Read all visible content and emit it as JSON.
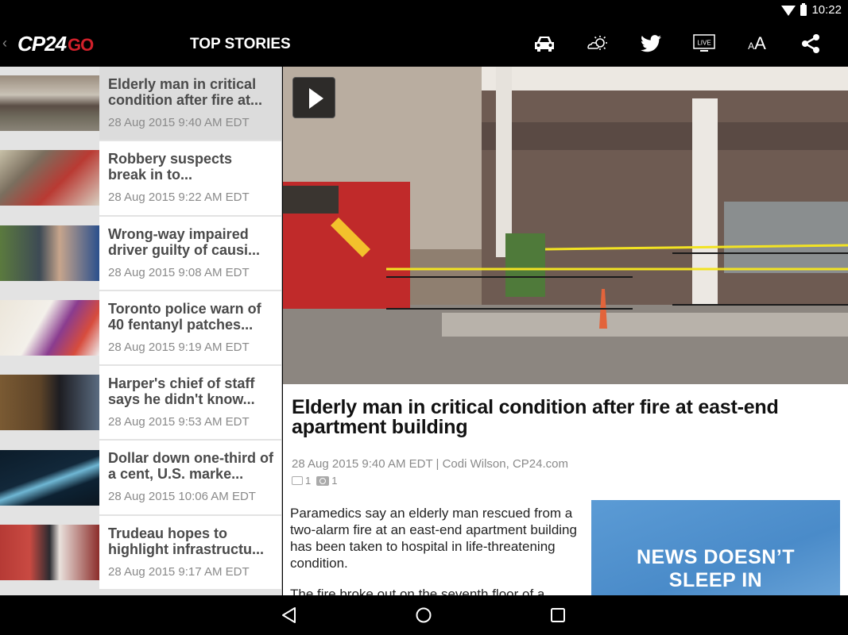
{
  "status_bar": {
    "time": "10:22",
    "icons": [
      "wifi-icon",
      "battery-icon"
    ]
  },
  "app_bar": {
    "logo_main": "CP24",
    "logo_suffix": "GO",
    "section_title": "TOP STORIES",
    "actions": [
      {
        "name": "traffic",
        "icon": "car-icon"
      },
      {
        "name": "weather",
        "icon": "weather-icon"
      },
      {
        "name": "twitter",
        "icon": "twitter-icon"
      },
      {
        "name": "live",
        "icon": "live-tv-icon",
        "label": "LIVE"
      },
      {
        "name": "text-size",
        "icon": "text-size-icon",
        "label_small": "A",
        "label_large": "A"
      },
      {
        "name": "share",
        "icon": "share-icon"
      }
    ],
    "colors": {
      "brand_red": "#d0202a"
    }
  },
  "stories": [
    {
      "title": "Elderly man in critical condition after fire at...",
      "date": "28 Aug 2015 9:40 AM EDT",
      "selected": true
    },
    {
      "title": "Robbery suspects break in to...",
      "date": "28 Aug 2015 9:22 AM EDT"
    },
    {
      "title": "Wrong-way impaired driver guilty of causi...",
      "date": "28 Aug 2015 9:08 AM EDT"
    },
    {
      "title": "Toronto police warn of 40 fentanyl patches...",
      "date": "28 Aug 2015 9:19 AM EDT"
    },
    {
      "title": "Harper's chief of staff says he didn't know...",
      "date": "28 Aug 2015 9:53 AM EDT"
    },
    {
      "title": "Dollar down one-third of a cent, U.S. marke...",
      "date": "28 Aug 2015 10:06 AM EDT"
    },
    {
      "title": "Trudeau hopes to highlight infrastructu...",
      "date": "28 Aug 2015 9:17 AM EDT"
    }
  ],
  "article": {
    "headline": "Elderly man in critical condition after fire at east-end apartment building",
    "byline": "28 Aug 2015 9:40 AM EDT | Codi Wilson, CP24.com",
    "comment_count": "1",
    "photo_count": "1",
    "paragraphs": [
      "Paramedics say an elderly man rescued from a two-alarm fire at an east-end apartment building has been taken to hospital in life-threatening condition.",
      "The fire broke out on the seventh floor of a"
    ],
    "ad": {
      "line1": "NEWS DOESN’T",
      "line2": "SLEEP IN"
    }
  },
  "nav_bar": {
    "buttons": [
      "back",
      "home",
      "recents"
    ]
  }
}
